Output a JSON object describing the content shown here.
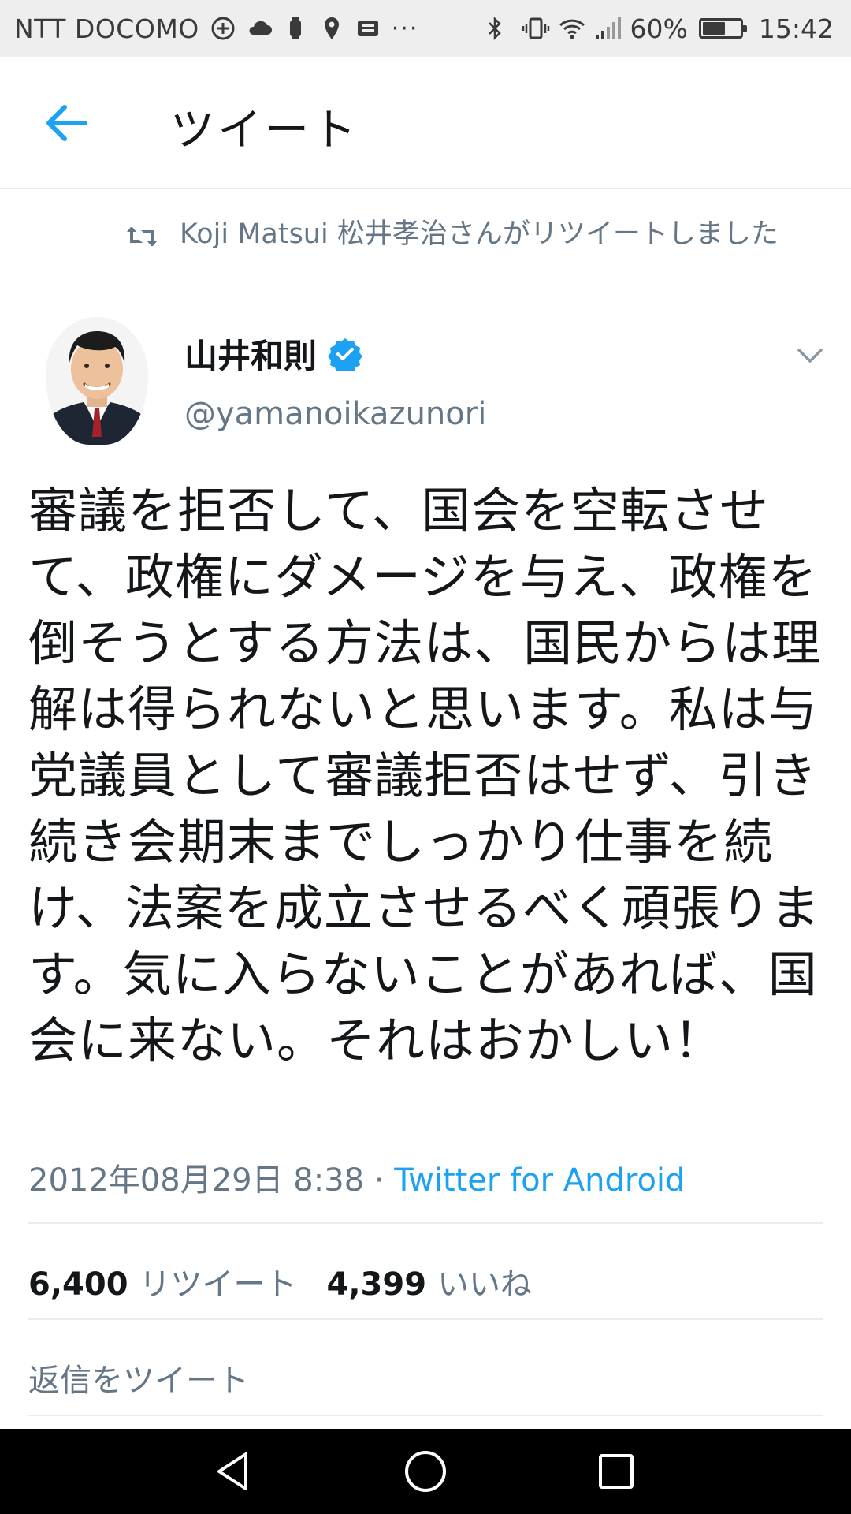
{
  "status_bar": {
    "carrier": "NTT DOCOMO",
    "battery_percent": "60%",
    "battery_level": 0.6,
    "time": "15:42",
    "more": "···"
  },
  "app_bar": {
    "title": "ツイート",
    "back_icon": "arrow-left-icon"
  },
  "retweet_context": {
    "icon": "retweet-icon",
    "text": "Koji Matsui 松井孝治さんがリツイートしました"
  },
  "tweet": {
    "author_name": "山井和則",
    "verified": true,
    "handle": "@yamanoikazunori",
    "text": "審議を拒否して、国会を空転させて、政権にダメージを与え、政権を倒そうとする方法は、国民からは理解は得られないと思います。私は与党議員として審議拒否はせず、引き続き会期末までしっかり仕事を続け、法案を成立させるべく頑張ります。気に入らないことがあれば、国会に来ない。それはおかしい！",
    "timestamp": "2012年08月29日 8:38",
    "separator": "·",
    "client": "Twitter for Android"
  },
  "stats": {
    "retweets_count": "6,400",
    "retweets_label": "リツイート",
    "likes_count": "4,399",
    "likes_label": "いいね"
  },
  "reply_placeholder": "返信をツイート",
  "colors": {
    "twitter_blue": "#1da1f2",
    "secondary_text": "#657786",
    "primary_text": "#14171a",
    "divider": "#e6ecf0"
  }
}
